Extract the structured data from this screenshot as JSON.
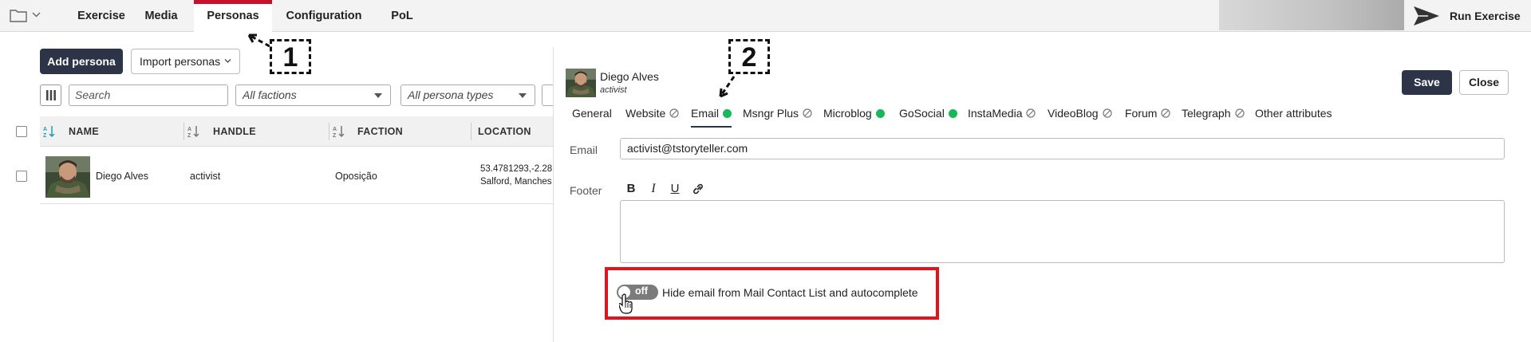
{
  "topnav": {
    "tabs": [
      {
        "label": "Exercise"
      },
      {
        "label": "Media"
      },
      {
        "label": "Personas"
      },
      {
        "label": "Configuration"
      },
      {
        "label": "PoL"
      }
    ],
    "active_tab": "Personas",
    "run_label": "Run Exercise",
    "accent_color": "#c8102e"
  },
  "personas_list": {
    "add_label": "Add persona",
    "import_label": "Import personas",
    "search_placeholder": "Search",
    "faction_filter": "All factions",
    "type_filter": "All persona types",
    "columns": [
      "NAME",
      "HANDLE",
      "FACTION",
      "LOCATION"
    ],
    "rows": [
      {
        "name": "Diego Alves",
        "handle": "activist",
        "faction": "Oposição",
        "location_coords": "53.4781293,-2.28",
        "location_place": "Salford, Manches"
      }
    ]
  },
  "editor": {
    "persona_name": "Diego Alves",
    "persona_handle": "activist",
    "save_label": "Save",
    "close_label": "Close",
    "tabs": [
      {
        "label": "General",
        "status": "none"
      },
      {
        "label": "Website",
        "status": "disabled"
      },
      {
        "label": "Email",
        "status": "enabled"
      },
      {
        "label": "Msngr Plus",
        "status": "disabled"
      },
      {
        "label": "Microblog",
        "status": "enabled"
      },
      {
        "label": "GoSocial",
        "status": "enabled"
      },
      {
        "label": "InstaMedia",
        "status": "disabled"
      },
      {
        "label": "VideoBlog",
        "status": "disabled"
      },
      {
        "label": "Forum",
        "status": "disabled"
      },
      {
        "label": "Telegraph",
        "status": "disabled"
      },
      {
        "label": "Other attributes",
        "status": "none"
      }
    ],
    "active_tab": "Email",
    "email_label": "Email",
    "email_value": "activist@tstoryteller.com",
    "footer_label": "Footer",
    "toolbar": [
      "B",
      "I",
      "U",
      "link-icon"
    ],
    "footer_value": "",
    "toggle_state": "off",
    "toggle_label": "Hide email from Mail Contact List and autocomplete",
    "enabled_color": "#16b85a",
    "highlight_color": "#e0141e"
  },
  "annotations": {
    "callout_1": "1",
    "callout_2": "2"
  }
}
